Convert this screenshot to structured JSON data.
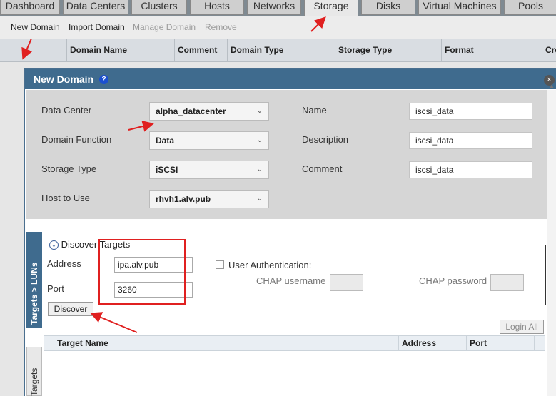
{
  "tabs": [
    {
      "label": "Dashboard",
      "active": false
    },
    {
      "label": "Data Centers",
      "active": false
    },
    {
      "label": "Clusters",
      "active": false
    },
    {
      "label": "Hosts",
      "active": false
    },
    {
      "label": "Networks",
      "active": false
    },
    {
      "label": "Storage",
      "active": true
    },
    {
      "label": "Disks",
      "active": false
    },
    {
      "label": "Virtual Machines",
      "active": false
    },
    {
      "label": "Pools",
      "active": false
    }
  ],
  "actions": {
    "new_domain": "New Domain",
    "import_domain": "Import Domain",
    "manage_domain": "Manage Domain",
    "remove": "Remove"
  },
  "grid_columns": [
    "Domain Name",
    "Comment",
    "Domain Type",
    "Storage Type",
    "Format",
    "Cro"
  ],
  "dialog": {
    "title": "New Domain",
    "help_glyph": "?",
    "close_glyph": "×",
    "fields": {
      "data_center": {
        "label": "Data Center",
        "value": "alpha_datacenter"
      },
      "domain_function": {
        "label": "Domain Function",
        "value": "Data"
      },
      "storage_type": {
        "label": "Storage Type",
        "value": "iSCSI"
      },
      "host_to_use": {
        "label": "Host to Use",
        "value": "rhvh1.alv.pub"
      },
      "name": {
        "label": "Name",
        "value": "iscsi_data"
      },
      "description": {
        "label": "Description",
        "value": "iscsi_data"
      },
      "comment": {
        "label": "Comment",
        "value": "iscsi_data"
      }
    },
    "side_tab": "Targets > LUNs",
    "side_tab2": "Targets",
    "discover": {
      "legend": "Discover Targets",
      "address_label": "Address",
      "address_value": "ipa.alv.pub",
      "port_label": "Port",
      "port_value": "3260",
      "discover_button": "Discover",
      "user_auth_label": "User Authentication:",
      "chap_username_label": "CHAP username",
      "chap_password_label": "CHAP password"
    },
    "login_all": "Login All",
    "target_columns": [
      "Target Name",
      "Address",
      "Port"
    ]
  },
  "colors": {
    "header_blue": "#3f6b8e",
    "annotation_red": "#e02020"
  }
}
